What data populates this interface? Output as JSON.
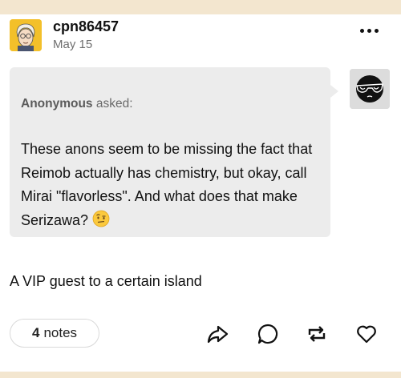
{
  "post": {
    "username": "cpn86457",
    "date": "May 15",
    "ask": {
      "asker_name": "Anonymous",
      "asked_label": "asked:",
      "question": "These anons seem to be missing the fact that Reimob actually has chemistry, but okay, call Mirai \"flavorless\". And what does that make Serizawa?",
      "emoji": "raised-eyebrow-emoji"
    },
    "answer": "A VIP guest to a certain island",
    "notes_count": "4",
    "notes_label": "notes"
  },
  "icons": {
    "more": "more-options-icon",
    "share": "share-icon",
    "reply": "reply-icon",
    "reblog": "reblog-icon",
    "like": "heart-icon"
  },
  "colors": {
    "page_band": "#f3e6cf",
    "card": "#ffffff",
    "bubble": "#ececec",
    "avatar_bg": "#f3c02a"
  }
}
